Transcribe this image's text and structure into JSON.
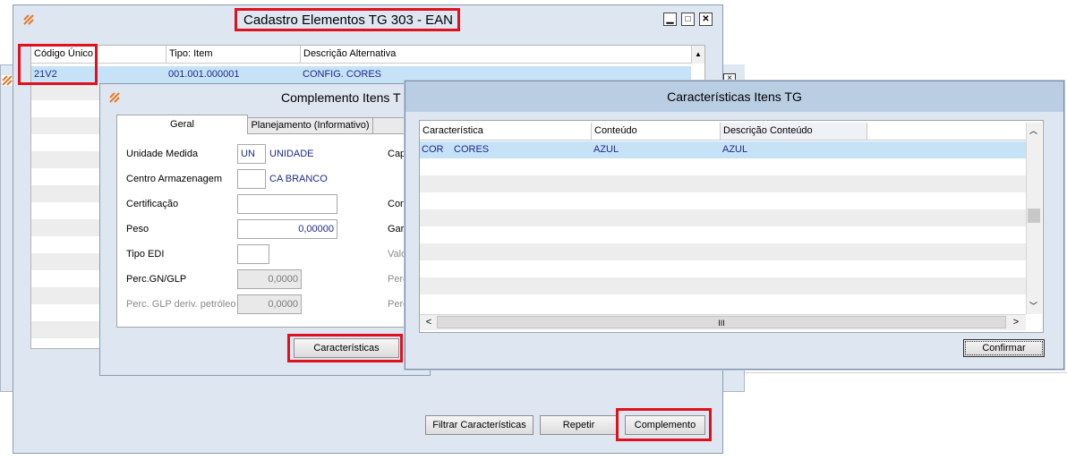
{
  "main_window": {
    "title": "Cadastro Elementos TG 303 - EAN",
    "columns": [
      "Código Único",
      "Tipo: Item",
      "Descrição Alternativa"
    ],
    "row": {
      "codigo": "21V2",
      "tipo": "001.001.000001",
      "descricao": "CONFIG. CORES"
    },
    "buttons": {
      "filtrar": "Filtrar Características",
      "repetir": "Repetir",
      "complemento": "Complemento"
    }
  },
  "complemento_window": {
    "title": "Complemento Itens T",
    "tabs": [
      "Geral",
      "Planejamento (Informativo)"
    ],
    "fields": {
      "unidade_medida": {
        "label": "Unidade Medida",
        "value": "UN",
        "desc": "UNIDADE"
      },
      "centro_armazenagem": {
        "label": "Centro Armazenagem",
        "value": "",
        "desc": "CA BRANCO"
      },
      "certificacao": {
        "label": "Certificação",
        "value": ""
      },
      "peso": {
        "label": "Peso",
        "value": "0,00000"
      },
      "tipo_edi": {
        "label": "Tipo EDI",
        "value": ""
      },
      "perc_gn_glp": {
        "label": "Perc.GN/GLP",
        "value": "0,0000"
      },
      "perc_glp_deriv": {
        "label": "Perc. GLP deriv. petróleo",
        "value": "0,0000"
      }
    },
    "right_labels": [
      "Cap",
      "Con",
      "Gar",
      "Valo",
      "Perc",
      "Perc"
    ],
    "caracteristicas_button": "Características"
  },
  "caracteristicas_window": {
    "title": "Características Itens TG",
    "columns": [
      "Característica",
      "Conteúdo",
      "Descrição Conteúdo"
    ],
    "row": {
      "codigo": "COR",
      "nome": "CORES",
      "conteudo": "AZUL",
      "descricao": "AZUL"
    },
    "confirmar": "Confirmar",
    "scroll_thumb": "III"
  },
  "colors": {
    "selected_row": "#c6e2f7",
    "highlight": "#e0101c",
    "blue_text": "#1c2a8c"
  }
}
